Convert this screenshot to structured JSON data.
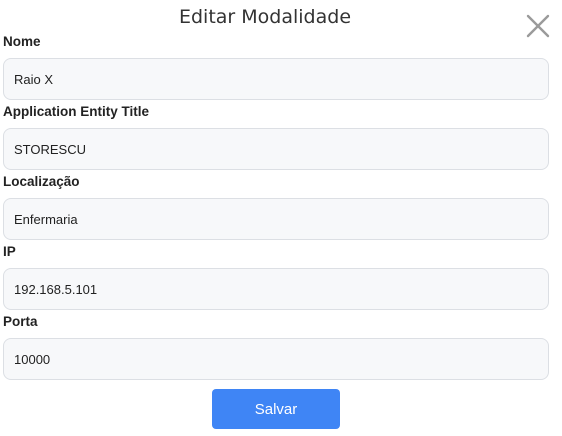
{
  "modal": {
    "title": "Editar Modalidade",
    "close_icon": "close-icon"
  },
  "fields": [
    {
      "label": "Nome",
      "value": "Raio X"
    },
    {
      "label": "Application Entity Title",
      "value": "STORESCU"
    },
    {
      "label": "Localização",
      "value": "Enfermaria"
    },
    {
      "label": "IP",
      "value": "192.168.5.101"
    },
    {
      "label": "Porta",
      "value": "10000"
    }
  ],
  "actions": {
    "save_label": "Salvar"
  },
  "colors": {
    "primary": "#3f85f5",
    "input_background": "#f7f8fa",
    "input_border": "#dcdfe4",
    "close_icon": "#9a9a9a"
  }
}
